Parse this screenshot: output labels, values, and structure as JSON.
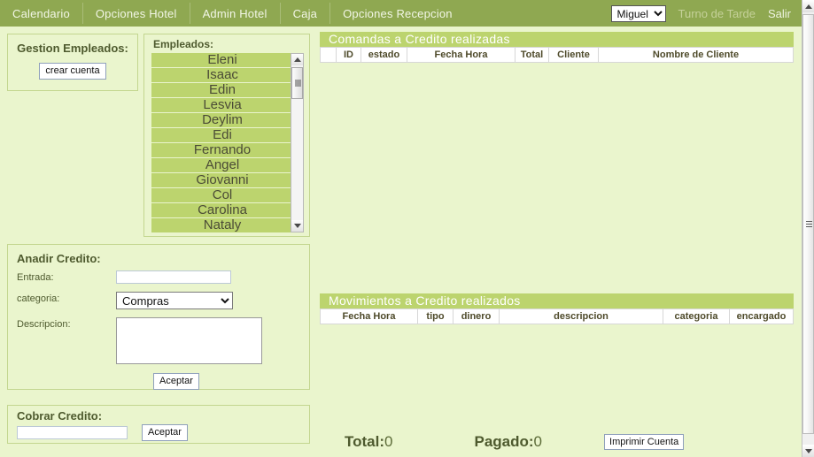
{
  "navbar": {
    "items": [
      {
        "label": "Calendario"
      },
      {
        "label": "Opciones Hotel"
      },
      {
        "label": "Admin Hotel"
      },
      {
        "label": "Caja"
      },
      {
        "label": "Opciones Recepcion"
      }
    ],
    "user_select": {
      "selected": "Miguel",
      "options": [
        "Miguel"
      ]
    },
    "turno": "Turno de Tarde",
    "logout": "Salir",
    "background_color": "#8fa851"
  },
  "gestion": {
    "title": "Gestion Empleados:",
    "crear_cuenta_label": "crear cuenta"
  },
  "empleados": {
    "title": "Empleados:",
    "items": [
      "Eleni",
      "Isaac",
      "Edin",
      "Lesvia",
      "Deylim",
      "Edi",
      "Fernando",
      "Angel",
      "Giovanni",
      "Col",
      "Carolina",
      "Nataly"
    ],
    "item_color": "#bcd46e"
  },
  "anadir_credito": {
    "title": "Anadir Credito:",
    "entrada_label": "Entrada:",
    "entrada_value": "",
    "categoria_label": "categoria:",
    "categoria_selected": "Compras",
    "categoria_options": [
      "Compras"
    ],
    "descripcion_label": "Descripcion:",
    "descripcion_value": "",
    "aceptar_label": "Aceptar"
  },
  "cobrar_credito": {
    "title": "Cobrar Credito:",
    "input_value": "",
    "aceptar_label": "Aceptar"
  },
  "comandas": {
    "header": "Comandas a Credito realizadas",
    "columns": [
      "",
      "ID",
      "estado",
      "Fecha Hora",
      "Total",
      "Cliente",
      "Nombre de Cliente"
    ],
    "rows": []
  },
  "movimientos": {
    "header": "Movimientos a Credito realizados",
    "columns": [
      "Fecha Hora",
      "tipo",
      "dinero",
      "descripcion",
      "categoria",
      "encargado"
    ],
    "rows": []
  },
  "totals": {
    "total_label": "Total:",
    "total_value": "0",
    "pagado_label": "Pagado:",
    "pagado_value": "0",
    "imprimir_label": "Imprimir Cuenta"
  },
  "theme": {
    "page_background": "#eaf5cd",
    "accent": "#8fa851",
    "section_header": "#bcd46e"
  }
}
